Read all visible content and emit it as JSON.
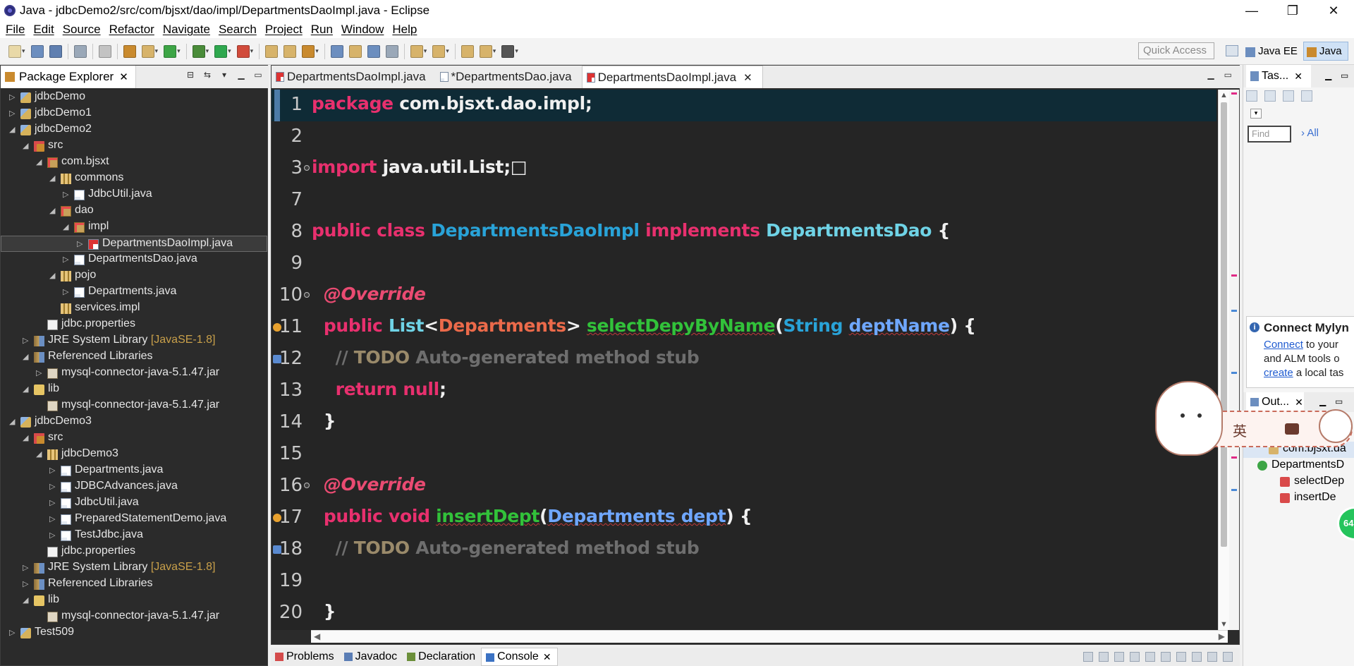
{
  "window": {
    "title": "Java - jdbcDemo2/src/com/bjsxt/dao/impl/DepartmentsDaoImpl.java - Eclipse",
    "minimize_label": "—",
    "restore_label": "❐",
    "close_label": "✕"
  },
  "menu": [
    "File",
    "Edit",
    "Source",
    "Refactor",
    "Navigate",
    "Search",
    "Project",
    "Run",
    "Window",
    "Help"
  ],
  "quick_access": "Quick Access",
  "perspectives": [
    {
      "label": "Java EE",
      "active": false
    },
    {
      "label": "Java",
      "active": true
    }
  ],
  "package_explorer": {
    "title": "Package Explorer",
    "tree": [
      {
        "label": "jdbcDemo",
        "depth": 0,
        "arrow": "▷",
        "icon": "project"
      },
      {
        "label": "jdbcDemo1",
        "depth": 0,
        "arrow": "▷",
        "icon": "project"
      },
      {
        "label": "jdbcDemo2",
        "depth": 0,
        "arrow": "◢",
        "icon": "project"
      },
      {
        "label": "src",
        "depth": 1,
        "arrow": "◢",
        "icon": "src"
      },
      {
        "label": "com.bjsxt",
        "depth": 2,
        "arrow": "◢",
        "icon": "package"
      },
      {
        "label": "commons",
        "depth": 3,
        "arrow": "◢",
        "icon": "package-plain"
      },
      {
        "label": "JdbcUtil.java",
        "depth": 4,
        "arrow": "▷",
        "icon": "java"
      },
      {
        "label": "dao",
        "depth": 3,
        "arrow": "◢",
        "icon": "package"
      },
      {
        "label": "impl",
        "depth": 4,
        "arrow": "◢",
        "icon": "package"
      },
      {
        "label": "DepartmentsDaoImpl.java",
        "depth": 5,
        "arrow": "▷",
        "icon": "java-err",
        "selected": true
      },
      {
        "label": "DepartmentsDao.java",
        "depth": 4,
        "arrow": "▷",
        "icon": "java"
      },
      {
        "label": "pojo",
        "depth": 3,
        "arrow": "◢",
        "icon": "package-plain"
      },
      {
        "label": "Departments.java",
        "depth": 4,
        "arrow": "▷",
        "icon": "java"
      },
      {
        "label": "services.impl",
        "depth": 3,
        "arrow": "",
        "icon": "package-plain"
      },
      {
        "label": "jdbc.properties",
        "depth": 2,
        "arrow": "",
        "icon": "props"
      },
      {
        "label": "JRE System Library",
        "suffix": "[JavaSE-1.8]",
        "depth": 1,
        "arrow": "▷",
        "icon": "lib"
      },
      {
        "label": "Referenced Libraries",
        "depth": 1,
        "arrow": "◢",
        "icon": "lib"
      },
      {
        "label": "mysql-connector-java-5.1.47.jar",
        "depth": 2,
        "arrow": "▷",
        "icon": "jar"
      },
      {
        "label": "lib",
        "depth": 1,
        "arrow": "◢",
        "icon": "folder"
      },
      {
        "label": "mysql-connector-java-5.1.47.jar",
        "depth": 2,
        "arrow": "",
        "icon": "jar"
      },
      {
        "label": "jdbcDemo3",
        "depth": 0,
        "arrow": "◢",
        "icon": "project"
      },
      {
        "label": "src",
        "depth": 1,
        "arrow": "◢",
        "icon": "src"
      },
      {
        "label": "jdbcDemo3",
        "depth": 2,
        "arrow": "◢",
        "icon": "package-plain"
      },
      {
        "label": "Departments.java",
        "depth": 3,
        "arrow": "▷",
        "icon": "java"
      },
      {
        "label": "JDBCAdvances.java",
        "depth": 3,
        "arrow": "▷",
        "icon": "java"
      },
      {
        "label": "JdbcUtil.java",
        "depth": 3,
        "arrow": "▷",
        "icon": "java"
      },
      {
        "label": "PreparedStatementDemo.java",
        "depth": 3,
        "arrow": "▷",
        "icon": "java"
      },
      {
        "label": "TestJdbc.java",
        "depth": 3,
        "arrow": "▷",
        "icon": "java"
      },
      {
        "label": "jdbc.properties",
        "depth": 2,
        "arrow": "",
        "icon": "props"
      },
      {
        "label": "JRE System Library",
        "suffix": "[JavaSE-1.8]",
        "depth": 1,
        "arrow": "▷",
        "icon": "lib"
      },
      {
        "label": "Referenced Libraries",
        "depth": 1,
        "arrow": "▷",
        "icon": "lib"
      },
      {
        "label": "lib",
        "depth": 1,
        "arrow": "◢",
        "icon": "folder"
      },
      {
        "label": "mysql-connector-java-5.1.47.jar",
        "depth": 2,
        "arrow": "",
        "icon": "jar"
      },
      {
        "label": "Test509",
        "depth": 0,
        "arrow": "▷",
        "icon": "project"
      }
    ]
  },
  "editor": {
    "tabs": [
      {
        "label": "DepartmentsDaoImpl.java",
        "active": false,
        "closable": false
      },
      {
        "label": "*DepartmentsDao.java",
        "active": false,
        "closable": false
      },
      {
        "label": "DepartmentsDaoImpl.java",
        "active": true,
        "closable": true
      }
    ],
    "lines": [
      {
        "n": "1",
        "current": true,
        "tokens": [
          [
            "kw",
            "package "
          ],
          [
            "pkgname",
            "com.bjsxt.dao.impl;"
          ]
        ]
      },
      {
        "n": "2",
        "tokens": []
      },
      {
        "n": "3",
        "fold": true,
        "tokens": [
          [
            "kw",
            "import "
          ],
          [
            "pkgname",
            "java.util.List;"
          ],
          [
            "punct",
            "□"
          ]
        ]
      },
      {
        "n": "7",
        "tokens": []
      },
      {
        "n": "8",
        "tokens": [
          [
            "kw",
            "public class "
          ],
          [
            "cls",
            "DepartmentsDaoImpl "
          ],
          [
            "kw",
            "implements "
          ],
          [
            "iface",
            "DepartmentsDao "
          ],
          [
            "punct",
            "{"
          ]
        ]
      },
      {
        "n": "9",
        "tokens": []
      },
      {
        "n": "10",
        "fold": true,
        "tokens": [
          [
            "punct",
            "  "
          ],
          [
            "ann",
            "@Override"
          ]
        ]
      },
      {
        "n": "11",
        "gutter": "error",
        "tokens": [
          [
            "punct",
            "  "
          ],
          [
            "kw",
            "public "
          ],
          [
            "iface",
            "List"
          ],
          [
            "punct",
            "<"
          ],
          [
            "type",
            "Departments"
          ],
          [
            "punct",
            "> "
          ],
          [
            "method",
            "selectDepyByName"
          ],
          [
            "punct",
            "("
          ],
          [
            "strtype",
            "String "
          ],
          [
            "param",
            "deptName"
          ],
          [
            "punct",
            ") {"
          ]
        ]
      },
      {
        "n": "12",
        "gutter": "task",
        "tokens": [
          [
            "punct",
            "    "
          ],
          [
            "cmt",
            "// "
          ],
          [
            "todo",
            "TODO "
          ],
          [
            "cmt",
            "Auto-generated method stub"
          ]
        ]
      },
      {
        "n": "13",
        "tokens": [
          [
            "punct",
            "    "
          ],
          [
            "kw",
            "return null"
          ],
          [
            "punct",
            ";"
          ]
        ]
      },
      {
        "n": "14",
        "tokens": [
          [
            "punct",
            "  }"
          ]
        ]
      },
      {
        "n": "15",
        "tokens": []
      },
      {
        "n": "16",
        "fold": true,
        "tokens": [
          [
            "punct",
            "  "
          ],
          [
            "ann",
            "@Override"
          ]
        ]
      },
      {
        "n": "17",
        "gutter": "error",
        "tokens": [
          [
            "punct",
            "  "
          ],
          [
            "kw",
            "public void "
          ],
          [
            "method",
            "insertDept"
          ],
          [
            "punct",
            "("
          ],
          [
            "param",
            "Departments dept"
          ],
          [
            "punct",
            ") {"
          ]
        ]
      },
      {
        "n": "18",
        "gutter": "task",
        "tokens": [
          [
            "punct",
            "    "
          ],
          [
            "cmt",
            "// "
          ],
          [
            "todo",
            "TODO "
          ],
          [
            "cmt",
            "Auto-generated method stub"
          ]
        ]
      },
      {
        "n": "19",
        "tokens": []
      },
      {
        "n": "20",
        "tokens": [
          [
            "punct",
            "  }"
          ]
        ]
      }
    ]
  },
  "bottom_tabs": [
    {
      "label": "Problems",
      "active": false
    },
    {
      "label": "Javadoc",
      "active": false
    },
    {
      "label": "Declaration",
      "active": false
    },
    {
      "label": "Console",
      "active": true
    }
  ],
  "right": {
    "task_tab": "Tas...",
    "find_placeholder": "Find",
    "find_all": "All",
    "mylyn_title": "Connect Mylyn",
    "mylyn_connect": "Connect",
    "mylyn_line1_rest": " to your",
    "mylyn_line2": "and ALM tools o",
    "mylyn_create": "create",
    "mylyn_line3_rest": " a local tas",
    "outline_tab": "Out...",
    "outline": [
      {
        "label": "com.bjsxt.da",
        "depth": 1,
        "sel": true
      },
      {
        "label": "DepartmentsD",
        "depth": 0
      },
      {
        "label": "selectDep",
        "depth": 2
      },
      {
        "label": "insertDe",
        "depth": 2
      }
    ]
  },
  "overlay": {
    "ime_text": "英",
    "badge_text": "64"
  },
  "colors": {
    "editor_bg": "#252525",
    "keyword": "#e8306e",
    "class": "#29a3d8",
    "current_line": "#0f2b36"
  }
}
